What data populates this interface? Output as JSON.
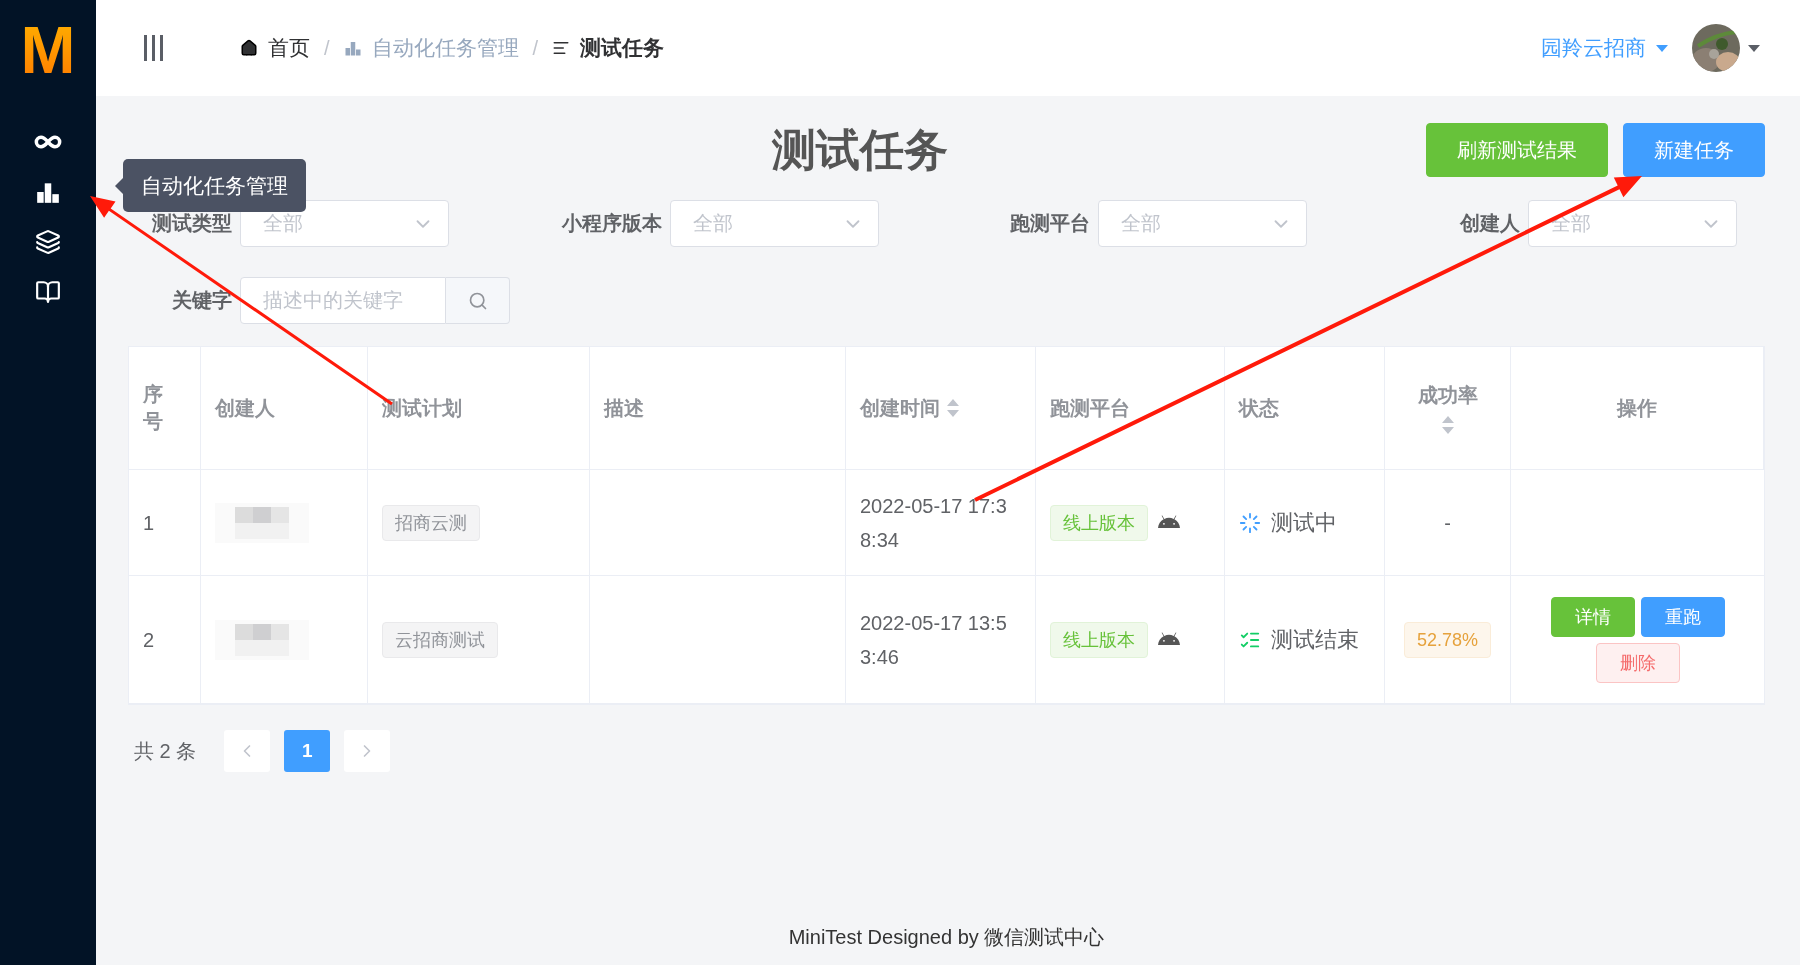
{
  "sidebar": {
    "logo": "M",
    "tooltip": "自动化任务管理"
  },
  "breadcrumb": [
    {
      "label": "首页",
      "current": false
    },
    {
      "label": "自动化任务管理",
      "current": false
    },
    {
      "label": "测试任务",
      "current": true
    }
  ],
  "breadcrumb_separators": [
    "/",
    "/"
  ],
  "user": {
    "name": "园羚云招商"
  },
  "title": "测试任务",
  "actions": [
    {
      "label": "刷新测试结果",
      "kind": "success"
    },
    {
      "label": "新建任务",
      "kind": "primary"
    }
  ],
  "filters": [
    {
      "label": "测试类型",
      "placeholder": "全部"
    },
    {
      "label": "小程序版本",
      "placeholder": "全部"
    },
    {
      "label": "跑测平台",
      "placeholder": "全部"
    },
    {
      "label": "创建人",
      "placeholder": "全部"
    }
  ],
  "keyword": {
    "label": "关键字",
    "placeholder": "描述中的关键字"
  },
  "table": {
    "columns": [
      {
        "label": "序号",
        "sortable": false
      },
      {
        "label": "创建人",
        "sortable": false
      },
      {
        "label": "测试计划",
        "sortable": false
      },
      {
        "label": "描述",
        "sortable": false
      },
      {
        "label": "创建时间",
        "sortable": true
      },
      {
        "label": "跑测平台",
        "sortable": false
      },
      {
        "label": "状态",
        "sortable": false
      },
      {
        "label": "成功率",
        "sortable": true
      },
      {
        "label": "操作",
        "sortable": false
      }
    ],
    "rows": [
      {
        "index": "1",
        "plan": "招商云测",
        "created": "2022-05-17 17:38:34",
        "platform": "线上版本",
        "status": {
          "text": "测试中",
          "kind": "running"
        },
        "rate": {
          "text": "-",
          "kind": "plain"
        }
      },
      {
        "index": "2",
        "plan": "云招商测试",
        "created": "2022-05-17 13:53:46",
        "platform": "线上版本",
        "status": {
          "text": "测试结束",
          "kind": "finished"
        },
        "rate": {
          "text": "52.78%",
          "kind": "tag"
        },
        "buttons": [
          {
            "label": "详情",
            "kind": "success"
          },
          {
            "label": "重跑",
            "kind": "primary"
          },
          {
            "label": "删除",
            "kind": "danger"
          }
        ]
      }
    ]
  },
  "pagination": {
    "total": "共 2 条",
    "pages": [
      {
        "label": "1",
        "selected": true
      }
    ]
  },
  "footer": "MiniTest Designed by 微信测试中心"
}
